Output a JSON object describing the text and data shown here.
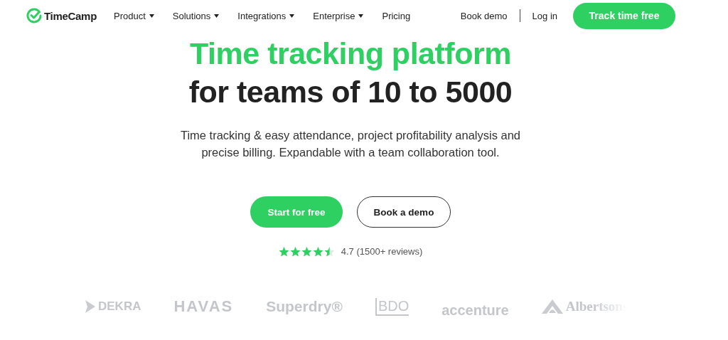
{
  "nav": {
    "brand": "TimeCamp",
    "links": [
      {
        "label": "Product",
        "dropdown": true
      },
      {
        "label": "Solutions",
        "dropdown": true
      },
      {
        "label": "Integrations",
        "dropdown": true
      },
      {
        "label": "Enterprise",
        "dropdown": true
      },
      {
        "label": "Pricing",
        "dropdown": false
      }
    ],
    "book_demo": "Book demo",
    "login": "Log in",
    "cta": "Track time free"
  },
  "hero": {
    "title_line_1": "Time tracking platform",
    "title_line_2": "for teams of 10 to 5000",
    "subtitle": "Time tracking & easy attendance, project profitability analysis and precise billing. Expandable with a team collaboration tool.",
    "primary_button": "Start for free",
    "secondary_button": "Book a demo",
    "rating": {
      "stars": 4.5,
      "text": "4.7 (1500+ reviews)"
    }
  },
  "client_logos": [
    {
      "kind": "dekra",
      "label": "DEKRA"
    },
    {
      "kind": "havas",
      "label": "HAVAS"
    },
    {
      "kind": "superdry",
      "label": "Superdry®"
    },
    {
      "kind": "bdo",
      "label": "BDO"
    },
    {
      "kind": "accenture",
      "label": "accenture"
    },
    {
      "kind": "albertsons",
      "label": "Albertsons"
    }
  ]
}
